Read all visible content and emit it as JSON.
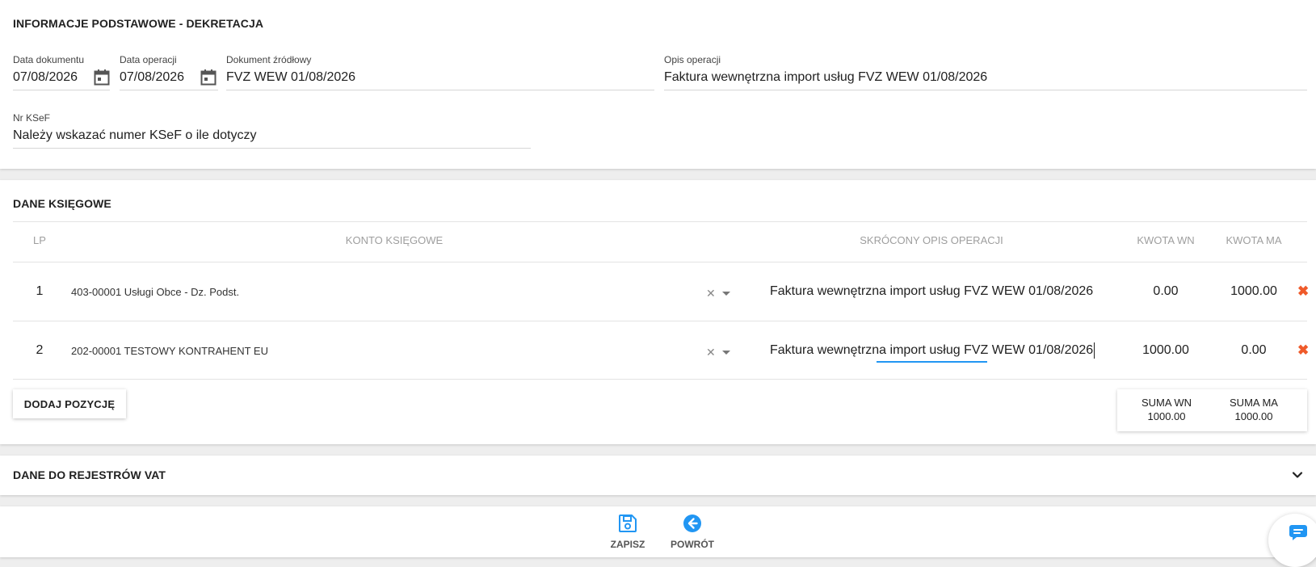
{
  "basic_info": {
    "title": "INFORMACJE PODSTAWOWE - DEKRETACJA",
    "doc_date_label": "Data dokumentu",
    "doc_date_value": "07/08/2026",
    "op_date_label": "Data operacji",
    "op_date_value": "07/08/2026",
    "source_doc_label": "Dokument źródłowy",
    "source_doc_value": "FVZ WEW 01/08/2026",
    "op_desc_label": "Opis operacji",
    "op_desc_value": "Faktura wewnętrzna import usług FVZ WEW 01/08/2026",
    "ksef_label": "Nr KSeF",
    "ksef_value": "Należy wskazać numer KSeF o ile dotyczy"
  },
  "accounting": {
    "title": "DANE KSIĘGOWE",
    "headers": {
      "lp": "LP",
      "account": "KONTO KSIĘGOWE",
      "short_desc": "SKRÓCONY OPIS OPERACJI",
      "wn": "KWOTA WN",
      "ma": "KWOTA MA"
    },
    "rows": [
      {
        "lp": "1",
        "account": "403-00001 Usługi Obce - Dz. Podst.",
        "desc": "Faktura wewnętrzna import usług FVZ WEW 01/08/2026",
        "wn": "0.00",
        "ma": "1000.00"
      },
      {
        "lp": "2",
        "account": "202-00001 TESTOWY KONTRAHENT EU",
        "desc": "Faktura wewnętrzna import usług FVZ WEW 01/08/2026",
        "wn": "1000.00",
        "ma": "0.00"
      }
    ],
    "clear_glyph": "✕",
    "delete_glyph": "✖",
    "add_button": "DODAJ POZYCJĘ",
    "sum_wn_label": "SUMA WN",
    "sum_wn_value": "1000.00",
    "sum_ma_label": "SUMA MA",
    "sum_ma_value": "1000.00"
  },
  "vat": {
    "title": "DANE DO REJESTRÓW VAT"
  },
  "toolbar": {
    "save_label": "ZAPISZ",
    "back_label": "POWRÓT"
  },
  "colors": {
    "accent": "#2196f3",
    "delete": "#ef5a2a"
  },
  "icons": {
    "calendar": "calendar-icon",
    "save": "floppy-disk-icon",
    "back": "arrow-left-circle-icon",
    "chat": "chat-bubble-icon",
    "expand": "chevron-down-icon"
  }
}
